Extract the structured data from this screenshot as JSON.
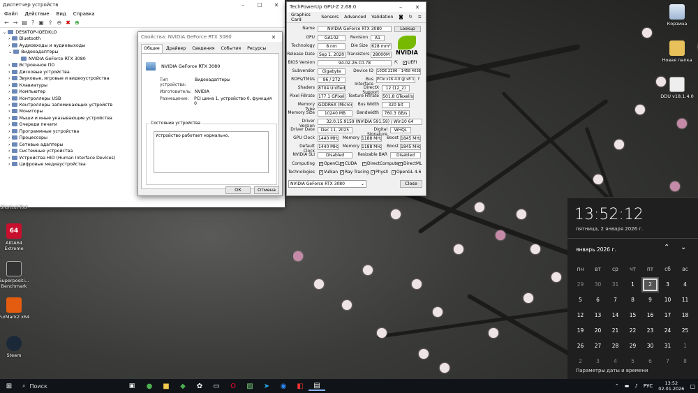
{
  "device_manager": {
    "title": "Диспетчер устройств",
    "menu": [
      "Файл",
      "Действие",
      "Вид",
      "Справка"
    ],
    "root": "DESKTOP-IQEDKLO",
    "items": [
      "Bluetooth",
      "Аудиовходы и аудиовыходы",
      "Видеоадаптеры",
      "NVIDIA GeForce RTX 3080",
      "Встроенное ПО",
      "Дисковые устройства",
      "Звуковые, игровые и видеоустройства",
      "Клавиатуры",
      "Компьютер",
      "Контроллеры USB",
      "Контроллеры запоминающих устройств",
      "Мониторы",
      "Мыши и иные указывающие устройства",
      "Очереди печати",
      "Программные устройства",
      "Процессоры",
      "Сетевые адаптеры",
      "Системные устройства",
      "Устройства HID (Human Interface Devices)",
      "Цифровые медиаустройства"
    ]
  },
  "properties": {
    "title": "Свойства: NVIDIA GeForce RTX 3080",
    "tabs": [
      "Общие",
      "Драйвер",
      "Сведения",
      "События",
      "Ресурсы"
    ],
    "device_name": "NVIDIA GeForce RTX 3080",
    "type_label": "Тип устройства:",
    "type_value": "Видеоадаптеры",
    "mfr_label": "Изготовитель:",
    "mfr_value": "NVIDIA",
    "loc_label": "Размещение:",
    "loc_value": "PCI шина 1, устройство 0, функция 0",
    "status_group": "Состояние устройства",
    "status_text": "Устройство работает нормально.",
    "ok": "ОК",
    "cancel": "Отмена"
  },
  "gpuz": {
    "title": "TechPowerUp GPU-Z 2.68.0",
    "tabs": [
      "Graphics Card",
      "Sensors",
      "Advanced",
      "Validation"
    ],
    "rows": {
      "name_l": "Name",
      "name_v": "NVIDIA GeForce RTX 3080",
      "lookup": "Lookup",
      "gpu_l": "GPU",
      "gpu_v": "GA102",
      "rev_l": "Revision",
      "rev_v": "A1",
      "tech_l": "Technology",
      "tech_v": "8 nm",
      "die_l": "Die Size",
      "die_v": "628 mm²",
      "rel_l": "Release Date",
      "rel_v": "Sep 1, 2020",
      "tr_l": "Transistors",
      "tr_v": "28000M",
      "bios_l": "BIOS Version",
      "bios_v": "94.02.26.C0.78",
      "uefi": "UEFI",
      "sub_l": "Subvendor",
      "sub_v": "Gigabyte",
      "dev_l": "Device ID",
      "dev_v": "10DE 2206 - 1458 403E",
      "rops_l": "ROPs/TMUs",
      "rops_v": "96 / 272",
      "bus_l": "Bus Interface",
      "bus_v": "PCIe x16 4.0 @ x8 1.1",
      "sh_l": "Shaders",
      "sh_v": "8704 Unified",
      "dx_l": "DirectX Support",
      "dx_v": "12 (12_2)",
      "px_l": "Pixel Fillrate",
      "px_v": "177.1 GPixel/s",
      "tx_l": "Texture Fillrate",
      "tx_v": "501.8 GTexel/s",
      "mt_l": "Memory Type",
      "mt_v": "GDDR6X (Micron)",
      "bw_l": "Bus Width",
      "bw_v": "320 bit",
      "ms_l": "Memory Size",
      "ms_v": "10240 MB",
      "bd_l": "Bandwidth",
      "bd_v": "760.3 GB/s",
      "dv_l": "Driver Version",
      "dv_v": "32.0.15.9159 (NVIDIA 591.59) / Win10 64",
      "dd_l": "Driver Date",
      "dd_v": "Dec 11, 2025",
      "ds_l": "Digital Signature",
      "ds_v": "WHQL",
      "gc_l": "GPU Clock",
      "gc_v": "1440 MHz",
      "gm_l": "Memory",
      "gm_v": "1188 MHz",
      "gb_l": "Boost",
      "gb_v": "1845 MHz",
      "dc_l": "Default Clock",
      "dc_v": "1440 MHz",
      "dm_l": "Memory",
      "dm_v": "1188 MHz",
      "db_l": "Boost",
      "db_v": "1845 MHz",
      "sli_l": "NVIDIA SLI",
      "sli_v": "Disabled",
      "rb_l": "Resizable BAR",
      "rb_v": "Disabled",
      "comp_l": "Computing",
      "tech2_l": "Technologies"
    },
    "computing": [
      "OpenCL",
      "CUDA",
      "DirectCompute",
      "DirectML"
    ],
    "technologies": [
      "Vulkan",
      "Ray Tracing",
      "PhysX",
      "OpenGL 4.6"
    ],
    "select_value": "NVIDIA GeForce RTX 3080",
    "close": "Close",
    "logo": "NVIDIA"
  },
  "desktop_icons": {
    "recycle": "Корзина",
    "new_folder": "Новая папка",
    "ddu": "DDU v18.1.4.0",
    "aida": "AIDA64 Extreme",
    "superposition": "Superpositi... Benchmark",
    "furmark": "FurMark2 x64",
    "steam": "Steam",
    "shortcut": "Shortcut Tool"
  },
  "clock": {
    "time": "13:52:12",
    "date": "пятница, 2 января 2026 г.",
    "month": "январь 2026 г.",
    "weekdays": [
      "пн",
      "вт",
      "ср",
      "чт",
      "пт",
      "сб",
      "вс"
    ],
    "weeks": [
      [
        "29",
        "30",
        "31",
        "1",
        "2",
        "3",
        "4"
      ],
      [
        "5",
        "6",
        "7",
        "8",
        "9",
        "10",
        "11"
      ],
      [
        "12",
        "13",
        "14",
        "15",
        "16",
        "17",
        "18"
      ],
      [
        "19",
        "20",
        "21",
        "22",
        "23",
        "24",
        "25"
      ],
      [
        "26",
        "27",
        "28",
        "29",
        "30",
        "31",
        "1"
      ],
      [
        "2",
        "3",
        "4",
        "5",
        "6",
        "7",
        "8"
      ]
    ],
    "settings_link": "Параметры даты и времени"
  },
  "taskbar": {
    "search": "Поиск",
    "lang": "РУС",
    "time": "13:52",
    "date": "02.01.2026"
  }
}
